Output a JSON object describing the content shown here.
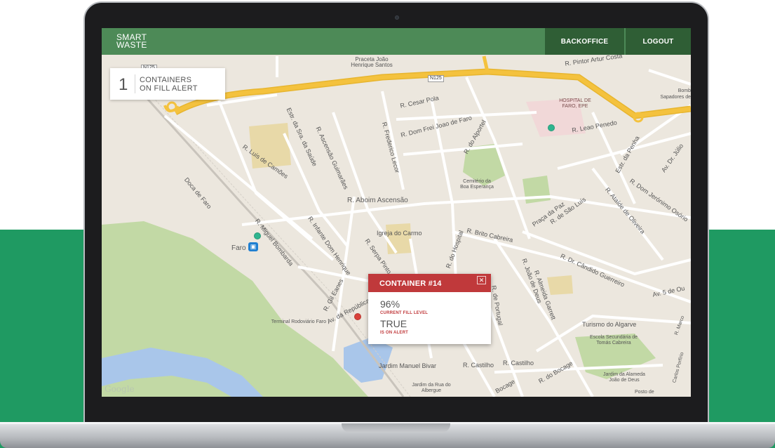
{
  "app": {
    "logo_line1": "SMART",
    "logo_line2": "WASTE",
    "nav": {
      "backoffice_label": "BACKOFFICE",
      "logout_label": "LOGOUT"
    }
  },
  "alert_summary": {
    "count": "1",
    "line1": "CONTAINERS",
    "line2": "ON FILL ALERT"
  },
  "popup": {
    "title": "CONTAINER #14",
    "close_glyph": "✕",
    "fill_value": "96%",
    "fill_label": "CURRENT FILL LEVEL",
    "alert_value": "TRUE",
    "alert_label": "IS ON ALERT",
    "header_color": "#c0393b"
  },
  "map": {
    "attribution": "Google",
    "road_tags": [
      "N125",
      "N125"
    ],
    "labels": {
      "praceta": "Praceta João Henrique Santos",
      "cesar_pola": "R. Cesar Pola",
      "dom_frei": "R. Dom Frei Joao de Faro",
      "do_alportel": "R. do Alportel",
      "hospital": "HOSPITAL DE FARO, EPE",
      "leao": "R. Leao Penedo",
      "pintor": "R. Pintor Artur Costa",
      "bombeiros": "Bomb Sapadores de",
      "luis_camoes": "R. Luis de Camões",
      "ascensao": "R. Ascensão Guimarães",
      "saude": "Estr. da Sra. da Saúde",
      "frederico": "R. Frederico Lecor",
      "cemiterio": "Cemitério da Boa Esperança",
      "aboim": "R. Aboim Ascensão",
      "doca": "Doca de Faro",
      "miguel": "R. Miguel Bombarda",
      "infante": "R. Infante Dom Henrique",
      "igreja": "Igreja do Carmo",
      "serpa": "R. Serpa Pinto",
      "hospital_r": "R. do Hospital",
      "brito": "R. Brito Cabreira",
      "paz": "Praça da Paz",
      "sao_luis": "R. de São Luís",
      "ataide": "R. Ataíde de Oliveira",
      "jeronimo": "R. Dom Jerónimo Osório",
      "julio": "Av. Dr. Júlio",
      "estr_penha": "Estr. da Penha",
      "faro": "Faro",
      "gil_eanes": "R. Gil Eanes",
      "republica": "Av. da República",
      "terminal": "Terminal Rodoviário Faro",
      "portugal": "R. de Portugal",
      "joao_deus": "R. João de Deus",
      "almeida": "R. Almeida Garrett",
      "candido": "R. Dr. Cândido Guerreiro",
      "av5": "Av. 5 de Ou",
      "turismo": "Turismo do Algarve",
      "escola": "Escola Secundária de Tomás Cabreira",
      "jardim_bivar": "Jardim Manuel Bivar",
      "castilho1": "R. Castilho",
      "castilho2": "R. Castilho",
      "bocage": "R. do Bocage",
      "bocage2": "Bocage",
      "jardim_rua": "Jardim da Rua do Albergue",
      "alameda": "Jardim da Alameda João de Deus",
      "posto": "Posto de",
      "portilho": "Carlos Porfírio",
      "marco": "R. Marco"
    }
  },
  "colors": {
    "header_green": "#4d8a57",
    "nav_dark_green": "#2f5e35",
    "backdrop_green": "#1f9a62",
    "highway_yellow": "#f4c23e",
    "water_blue": "#a9c6ea",
    "park_green": "#c2d9a5",
    "marker_teal": "#2fb58f",
    "marker_red": "#d9413a"
  },
  "icons": [
    "bus-stop-icon",
    "container-marker",
    "close-icon"
  ]
}
